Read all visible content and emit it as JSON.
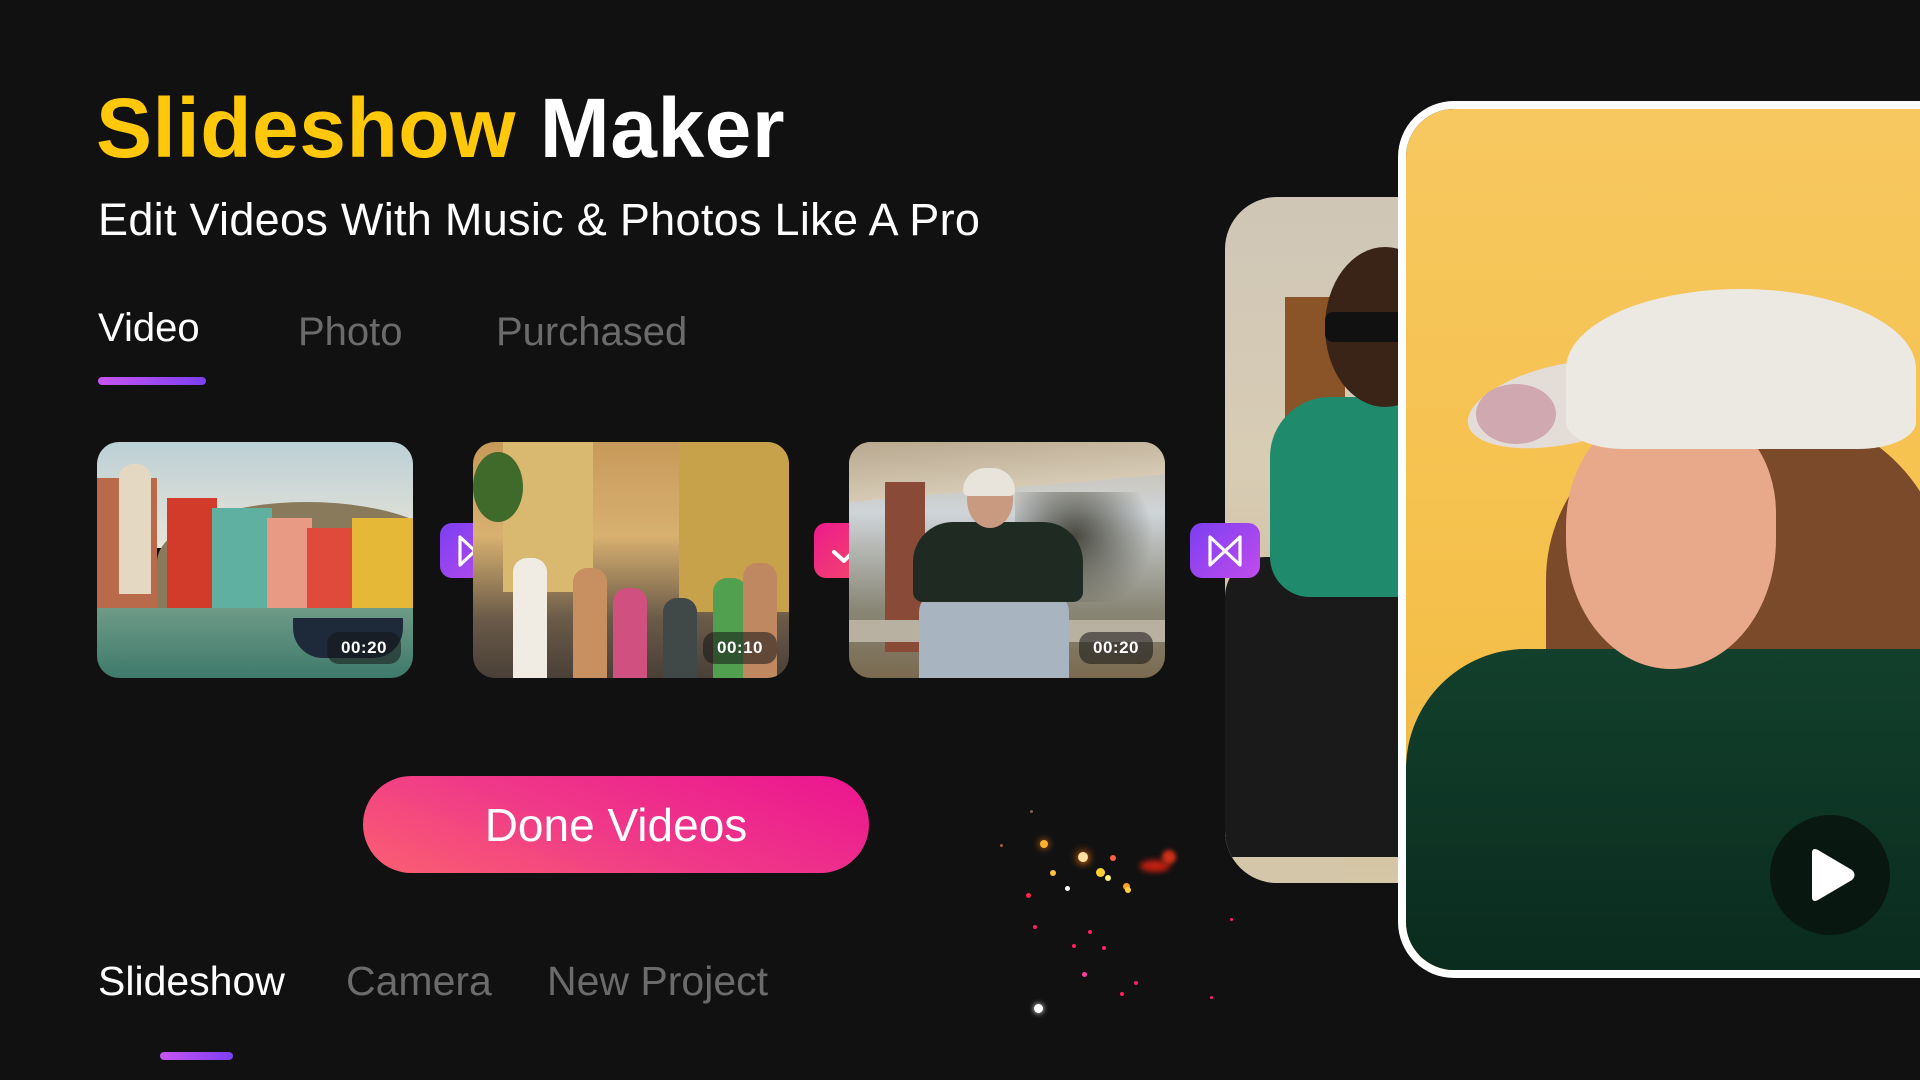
{
  "header": {
    "title_accent": "Slideshow",
    "title_rest": "Maker",
    "subtitle": "Edit Videos With Music & Photos Like A Pro"
  },
  "media_tabs": {
    "active": "Video",
    "items": [
      {
        "label": "Video"
      },
      {
        "label": "Photo"
      },
      {
        "label": "Purchased"
      }
    ]
  },
  "clips": [
    {
      "duration": "00:20",
      "scene": "coastal-town"
    },
    {
      "duration": "00:10",
      "scene": "busy-street"
    },
    {
      "duration": "00:20",
      "scene": "man-on-bench"
    }
  ],
  "badges": {
    "transition_icon": "transition-icon",
    "check_icon": "check-icon"
  },
  "actions": {
    "done_label": "Done Videos"
  },
  "bottom_tabs": {
    "active": "Slideshow",
    "items": [
      {
        "label": "Slideshow"
      },
      {
        "label": "Camera"
      },
      {
        "label": "New Project"
      }
    ]
  },
  "preview": {
    "play_icon": "play-icon"
  },
  "colors": {
    "accent_yellow": "#FFC80A",
    "background": "#111112",
    "transition_gradient": [
      "#7B3FF2",
      "#C14CEB"
    ],
    "check_gradient": [
      "#EC1A8C",
      "#F55067"
    ],
    "button_gradient": [
      "#FA6070",
      "#EB1490"
    ],
    "tab_indicator": [
      "#C855F0",
      "#7B3FF2"
    ],
    "inactive_text": "#6b6b6b"
  }
}
